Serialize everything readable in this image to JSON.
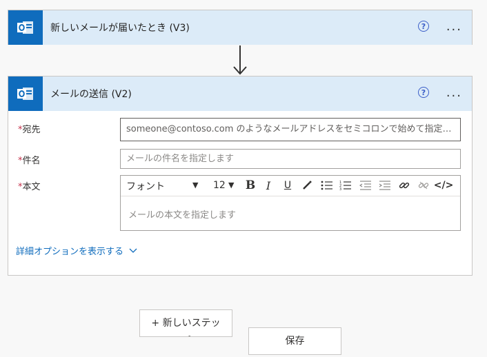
{
  "trigger": {
    "title": "新しいメールが届いたとき (V3)",
    "help": "?",
    "more": "..."
  },
  "action": {
    "title": "メールの送信 (V2)",
    "help": "?",
    "more": "...",
    "fields": {
      "to_label": "宛先",
      "to_placeholder": "someone@contoso.com のようなメールアドレスをセミコロンで始めて指定し...",
      "subject_label": "件名",
      "subject_placeholder": "メールの件名を指定します",
      "body_label": "本文",
      "body_placeholder": "メールの本文を指定します",
      "required_mark": "*"
    },
    "toolbar": {
      "font": "フォント",
      "size": "12",
      "bold": "B",
      "italic": "I",
      "underline": "U",
      "code": "</>"
    },
    "advanced_link": "詳細オプションを表示する"
  },
  "buttons": {
    "new_step": "+ 新しいステップ",
    "save": "保存"
  },
  "colors": {
    "header_bg": "#dcebf8",
    "icon_bg": "#0f6cbd",
    "required": "#c4314b",
    "link": "#0f6cbd"
  }
}
